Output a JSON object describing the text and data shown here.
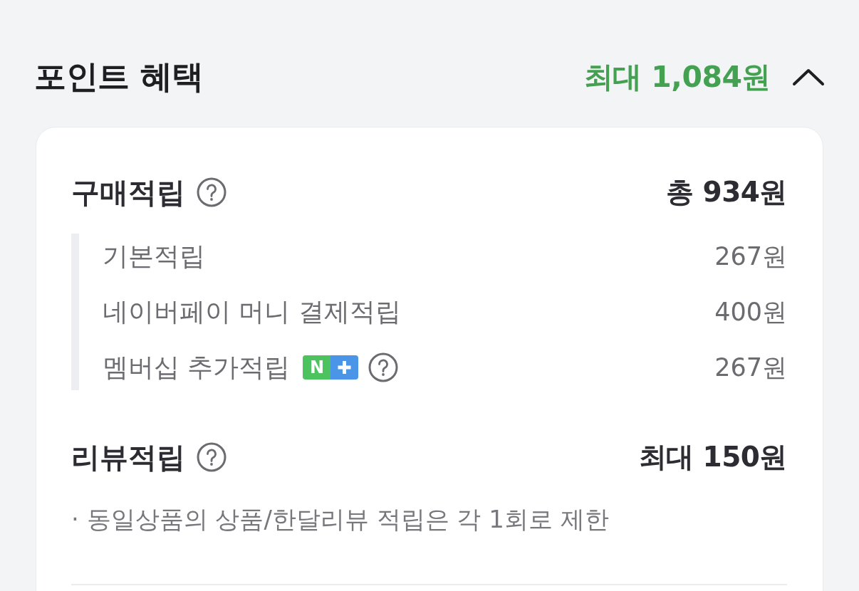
{
  "section": {
    "title": "포인트 혜택",
    "total": "최대 1,084원",
    "expanded": true
  },
  "groups": [
    {
      "title": "구매적립",
      "help": true,
      "amount": "총 934원",
      "items": [
        {
          "label": "기본적립",
          "amount": "267원"
        },
        {
          "label": "네이버페이 머니 결제적립",
          "amount": "400원"
        },
        {
          "label": "멤버십 추가적립",
          "badge": {
            "letter": "N"
          },
          "help": true,
          "amount": "267원"
        }
      ]
    },
    {
      "title": "리뷰적립",
      "help": true,
      "amount": "최대 150원",
      "notes": [
        "· 동일상품의 상품/한달리뷰 적립은 각 1회로 제한"
      ]
    }
  ]
}
